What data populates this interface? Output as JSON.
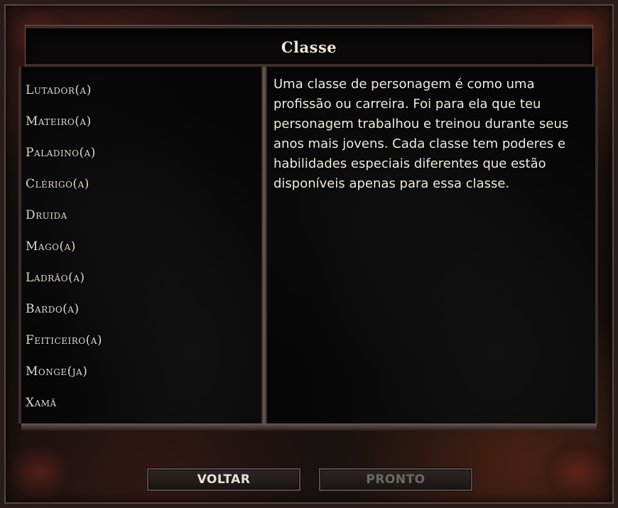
{
  "window": {
    "title": "Classe"
  },
  "classes": [
    {
      "label": "Lutador(a)"
    },
    {
      "label": "Mateiro(a)"
    },
    {
      "label": "Paladino(a)"
    },
    {
      "label": "Clérigo(a)"
    },
    {
      "label": "Druida"
    },
    {
      "label": "Mago(a)"
    },
    {
      "label": "Ladrão(a)"
    },
    {
      "label": "Bardo(a)"
    },
    {
      "label": "Feiticeiro(a)"
    },
    {
      "label": "Monge(ja)"
    },
    {
      "label": "Xamã"
    }
  ],
  "description": "Uma classe de personagem é como uma profissão ou carreira. Foi para ela que teu personagem trabalhou e treinou durante seus anos mais jovens. Cada classe tem poderes e habilidades especiais diferentes que estão disponíveis apenas para essa classe.",
  "buttons": {
    "back_label": "VOLTAR",
    "ready_label": "PRONTO",
    "ready_enabled": false
  },
  "colors": {
    "title_text": "#efe6d2",
    "list_text": "#e0dace",
    "description_text": "#f0ece2",
    "disabled_text": "#6d6866",
    "frame_accent": "#5a4742"
  }
}
